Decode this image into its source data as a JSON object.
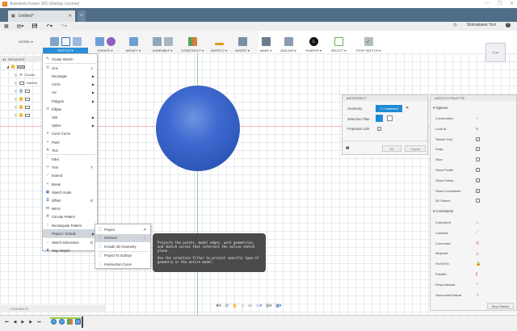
{
  "window": {
    "title": "Autodesk Fusion 360 (Startup License)",
    "controls": [
      "—",
      "❐",
      "✕"
    ]
  },
  "tab": {
    "label": "Untitled*",
    "close": "✕",
    "new": "+"
  },
  "user": {
    "name": "Shimakawa Yozi",
    "help": "?"
  },
  "ribbon": {
    "workspace": "MODEL ▾",
    "groups": [
      "SKETCH ▾",
      "CREATE ▾",
      "MODIFY ▾",
      "ASSEMBLE ▾",
      "CONSTRUCT ▾",
      "INSPECT ▾",
      "INSERT ▾",
      "MAKE ▾",
      "ADD-INS ▾",
      "SHAPER ▾",
      "SELECT ▾",
      "STOP SKETCH ▾"
    ]
  },
  "browser": {
    "title": "BROWSER",
    "items": [
      "Docum",
      "Named",
      "",
      "",
      "",
      ""
    ]
  },
  "sketch_menu": {
    "items": [
      {
        "label": "Create Sketch",
        "icon": "✎"
      },
      {
        "label": "Line",
        "shortcut": "L",
        "icon": "⟲"
      },
      {
        "label": "Rectangle",
        "sub": true
      },
      {
        "label": "Circle",
        "sub": true
      },
      {
        "label": "Arc",
        "sub": true
      },
      {
        "label": "Polygon",
        "sub": true
      },
      {
        "label": "Ellipse",
        "icon": "⬭"
      },
      {
        "label": "Slot",
        "sub": true
      },
      {
        "label": "Spline",
        "sub": true
      },
      {
        "label": "Conic Curve",
        "icon": "∧"
      },
      {
        "label": "Point",
        "icon": "+"
      },
      {
        "label": "Text",
        "icon": "A"
      },
      {
        "label": "Fillet",
        "icon": "⌜"
      },
      {
        "label": "Trim",
        "shortcut": "T",
        "icon": "✂"
      },
      {
        "label": "Extend",
        "icon": "⟋"
      },
      {
        "label": "Break",
        "icon": "+"
      },
      {
        "label": "Sketch Scale",
        "icon": "▣"
      },
      {
        "label": "Offset",
        "shortcut": "O",
        "icon": "⧉"
      },
      {
        "label": "Mirror",
        "icon": "⋈"
      },
      {
        "label": "Circular Pattern",
        "icon": "✲"
      },
      {
        "label": "Rectangular Pattern",
        "icon": "⁞"
      },
      {
        "label": "Project / Include",
        "sub": true
      },
      {
        "label": "Sketch Dimension",
        "shortcut": "D",
        "icon": "↔"
      },
      {
        "label": "Stop Sketch",
        "icon": "■"
      }
    ]
  },
  "submenu": {
    "items": [
      {
        "label": "Project",
        "shortcut": "P"
      },
      {
        "label": "Intersect",
        "shortcut": "⋮"
      },
      {
        "label": "Include 3D Geometry"
      },
      {
        "label": "Project To Surface"
      },
      {
        "label": "Intersection Curve"
      }
    ]
  },
  "tooltip": {
    "p1": "Projects the points, model edges, work geometries, and sketch curves that intersect the active sketch plane.",
    "p2": "Use the selection filter to project specific type of geometry or the entire model."
  },
  "intersect": {
    "title": "INTERSECT",
    "geometry_label": "Geometry",
    "geometry_value": "1 selected",
    "filter_label": "Selection Filter",
    "link_label": "Projection Link",
    "link_checked": true,
    "ok": "OK",
    "cancel": "Cancel"
  },
  "palette": {
    "title": "SKETCH PALETTE",
    "options_header": "Options",
    "options": [
      {
        "label": "Construction",
        "value": "icon"
      },
      {
        "label": "Look At",
        "value": "icon"
      },
      {
        "label": "Sketch Grid",
        "checked": true
      },
      {
        "label": "Snap",
        "checked": true
      },
      {
        "label": "Slice",
        "checked": false
      },
      {
        "label": "Show Profile",
        "checked": true
      },
      {
        "label": "Show Points",
        "checked": true
      },
      {
        "label": "Show Constraints",
        "checked": true
      },
      {
        "label": "3D Sketch",
        "checked": false
      }
    ],
    "constraints_header": "Constraints",
    "constraints": [
      {
        "label": "Coincident",
        "icon": "∟"
      },
      {
        "label": "Collinear",
        "icon": "⟋"
      },
      {
        "label": "Concentric",
        "icon": "◎"
      },
      {
        "label": "Midpoint",
        "icon": "△"
      },
      {
        "label": "Fix/UnFix",
        "icon": "🔒"
      },
      {
        "label": "Parallel",
        "icon": "∥"
      },
      {
        "label": "Perpendicular",
        "icon": "✓"
      },
      {
        "label": "Horizontal/Vertical",
        "icon": "⊥"
      }
    ],
    "stop": "Stop Sketch"
  },
  "viewcube": {
    "face": "TOP"
  },
  "comments": {
    "title": "COMMENTS"
  },
  "colors": {
    "accent": "#2b8fd8",
    "tabbar": "#4f6d87",
    "sphere": "#3a64c8"
  }
}
